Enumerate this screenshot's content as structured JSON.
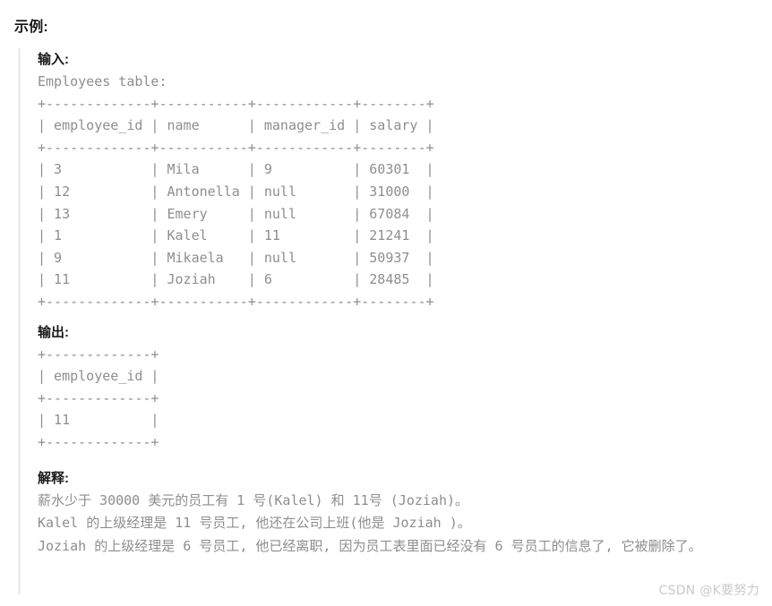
{
  "section": {
    "title": "示例:"
  },
  "input": {
    "label": "输入:",
    "table_caption": "Employees table:",
    "table": {
      "columns": [
        "employee_id",
        "name",
        "manager_id",
        "salary"
      ],
      "rows": [
        [
          "3",
          "Mila",
          "9",
          "60301"
        ],
        [
          "12",
          "Antonella",
          "null",
          "31000"
        ],
        [
          "13",
          "Emery",
          "null",
          "67084"
        ],
        [
          "1",
          "Kalel",
          "11",
          "21241"
        ],
        [
          "9",
          "Mikaela",
          "null",
          "50937"
        ],
        [
          "11",
          "Joziah",
          "6",
          "28485"
        ]
      ],
      "ascii": "+-------------+-----------+------------+--------+\n| employee_id | name      | manager_id | salary |\n+-------------+-----------+------------+--------+\n| 3           | Mila      | 9          | 60301  |\n| 12          | Antonella | null       | 31000  |\n| 13          | Emery     | null       | 67084  |\n| 1           | Kalel     | 11         | 21241  |\n| 9           | Mikaela   | null       | 50937  |\n| 11          | Joziah    | 6          | 28485  |\n+-------------+-----------+------------+--------+"
    }
  },
  "output": {
    "label": "输出:",
    "table": {
      "columns": [
        "employee_id"
      ],
      "rows": [
        [
          "11"
        ]
      ],
      "ascii": "+-------------+\n| employee_id |\n+-------------+\n| 11          |\n+-------------+"
    }
  },
  "explanation": {
    "label": "解释:",
    "lines": [
      "薪水少于 30000 美元的员工有 1 号(Kalel) 和 11号 (Joziah)。",
      "Kalel 的上级经理是 11 号员工, 他还在公司上班(他是 Joziah )。",
      "Joziah 的上级经理是 6 号员工, 他已经离职, 因为员工表里面已经没有 6 号员工的信息了, 它被删除了。"
    ]
  },
  "watermark": {
    "text": "CSDN @K要努力"
  },
  "colors": {
    "background": "#ffffff",
    "heading_text": "#1a1a1a",
    "mono_text": "#8e8e8e",
    "quote_bar": "#ededed",
    "watermark_text": "#c9c9c9"
  }
}
